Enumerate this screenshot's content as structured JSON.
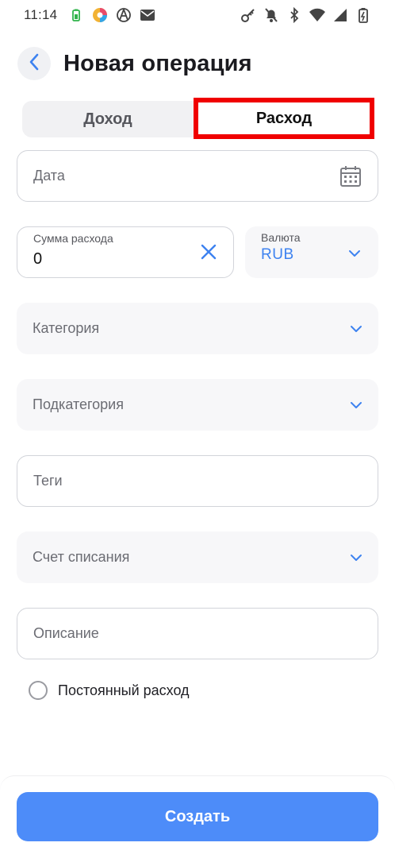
{
  "status_bar": {
    "time": "11:14",
    "icons_left": [
      "battery-saver-icon",
      "colorful-app-icon",
      "anarchy-icon",
      "mail-icon"
    ],
    "icons_right": [
      "key-icon",
      "bell-off-icon",
      "bluetooth-icon",
      "wifi-icon",
      "signal-icon",
      "battery-icon"
    ]
  },
  "header": {
    "title": "Новая операция"
  },
  "tabs": {
    "income": "Доход",
    "expense": "Расход",
    "selected": "expense"
  },
  "form": {
    "date_placeholder": "Дата",
    "amount_label": "Сумма расхода",
    "amount_value": "0",
    "currency_label": "Валюта",
    "currency_value": "RUB",
    "category_placeholder": "Категория",
    "subcategory_placeholder": "Подкатегория",
    "tags_placeholder": "Теги",
    "account_placeholder": "Счет списания",
    "description_placeholder": "Описание",
    "recurring_label": "Постоянный расход",
    "recurring_checked": false
  },
  "actions": {
    "create_label": "Создать"
  },
  "colors": {
    "accent": "#4d8cf9",
    "accent_text": "#3d82f0",
    "highlight": "#f00000"
  }
}
